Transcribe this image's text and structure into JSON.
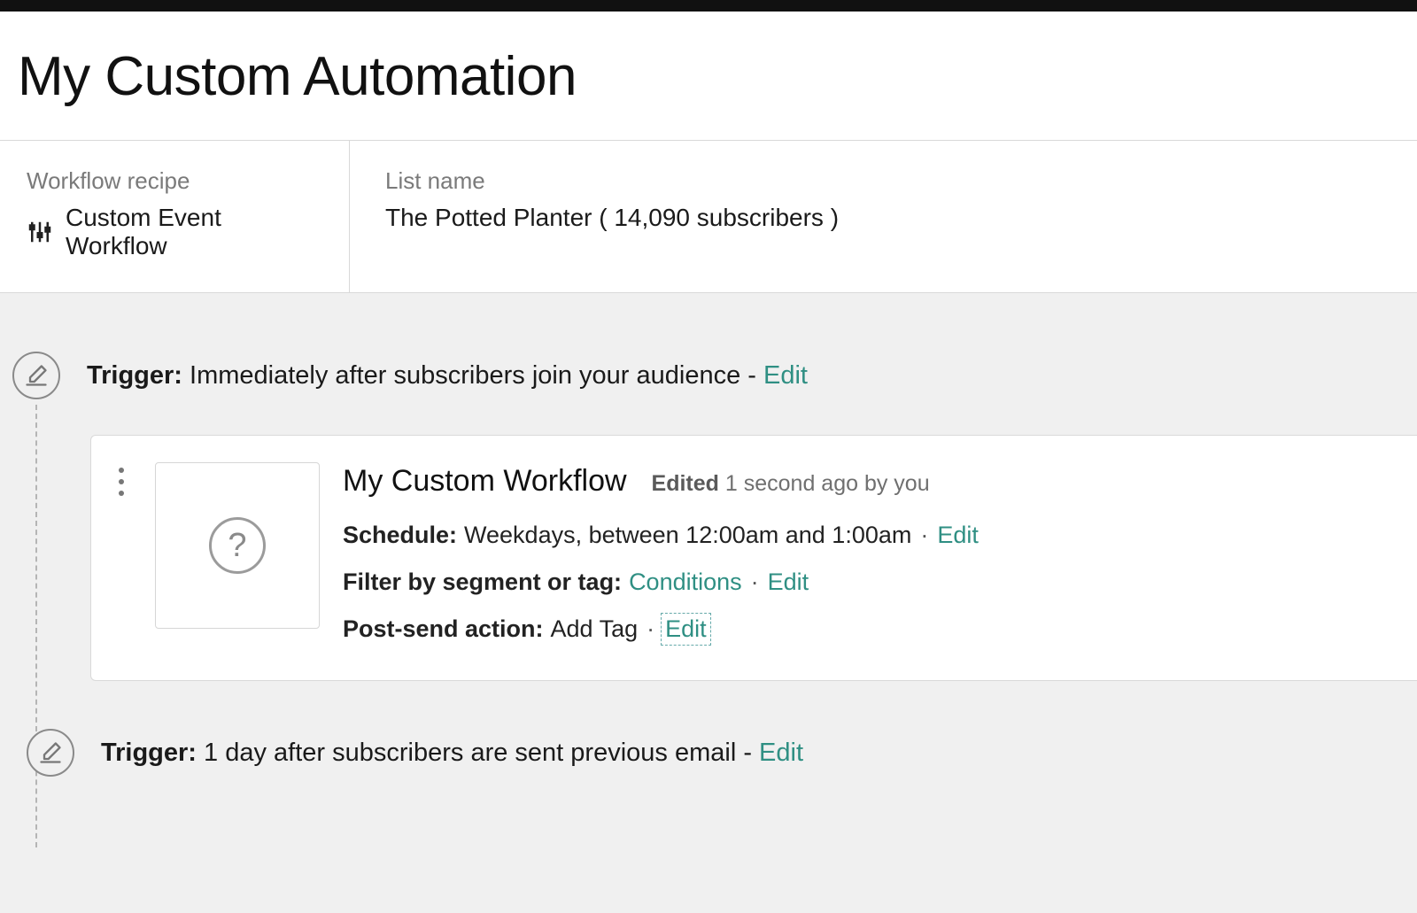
{
  "page": {
    "title": "My Custom Automation"
  },
  "meta": {
    "recipe_label": "Workflow recipe",
    "recipe_value": "Custom Event Workflow",
    "list_label": "List name",
    "list_value": "The Potted Planter ( 14,090 subscribers )"
  },
  "trigger1": {
    "label": "Trigger:",
    "text": "Immediately after subscribers join your audience",
    "dash": " - ",
    "edit": "Edit"
  },
  "card": {
    "title": "My Custom Workflow",
    "edited_prefix": "Edited",
    "edited_rest": " 1 second ago by you",
    "schedule_label": "Schedule:",
    "schedule_value": "Weekdays, between 12:00am and 1:00am",
    "schedule_edit": "Edit",
    "filter_label": "Filter by segment or tag:",
    "filter_value": "Conditions",
    "filter_edit": "Edit",
    "action_label": "Post-send action:",
    "action_value": "Add Tag",
    "action_edit": "Edit",
    "separator": "·"
  },
  "trigger2": {
    "label": "Trigger:",
    "text": "1 day after subscribers are sent previous email",
    "dash": " - ",
    "edit": "Edit"
  }
}
